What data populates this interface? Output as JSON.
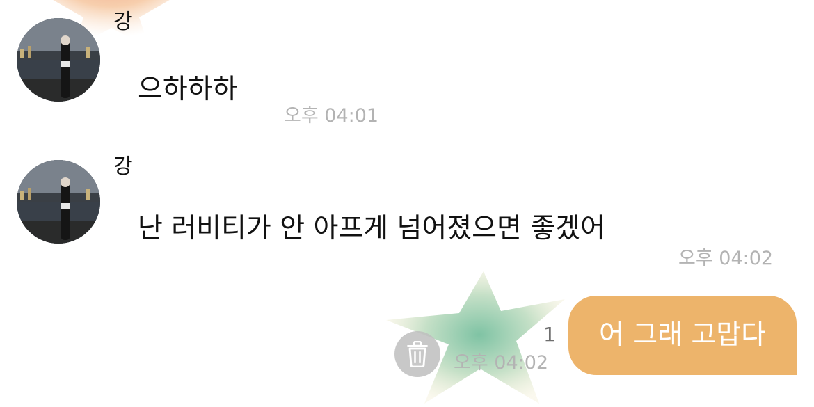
{
  "messages": [
    {
      "sender": "강",
      "text": "으하하하",
      "time": "오후 04:01",
      "avatar": "profile-photo"
    },
    {
      "sender": "강",
      "text": "난 러비티가 안 아프게 넘어졌으면 좋겠어",
      "time": "오후 04:02",
      "avatar": "profile-photo"
    }
  ],
  "outgoing": {
    "text": "어 그래 고맙다",
    "time": "오후 04:02",
    "unread": "1",
    "bubble_color": "#edb46b"
  },
  "actions": {
    "delete_icon": "trash-icon"
  }
}
